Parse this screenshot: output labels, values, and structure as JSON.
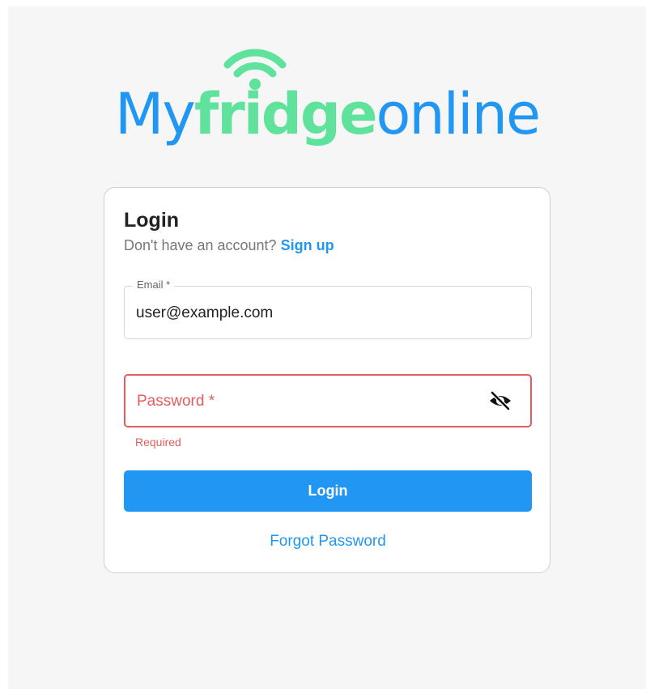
{
  "logo": {
    "part_my": "My",
    "part_fridge": "fridge",
    "part_online": "online",
    "icon": "wifi-icon",
    "colors": {
      "blue": "#2196f3",
      "green": "#5fe29b"
    }
  },
  "login_card": {
    "title": "Login",
    "signup_prompt": "Don't have an account?",
    "signup_link": "Sign up",
    "email": {
      "label": "Email *",
      "value": "user@example.com"
    },
    "password": {
      "label": "Password *",
      "value": "",
      "toggle_icon": "eye-off-icon",
      "error": "Required"
    },
    "login_button": "Login",
    "forgot_password": "Forgot Password"
  },
  "colors": {
    "accent": "#2196f3",
    "error": "#e35d5d"
  }
}
